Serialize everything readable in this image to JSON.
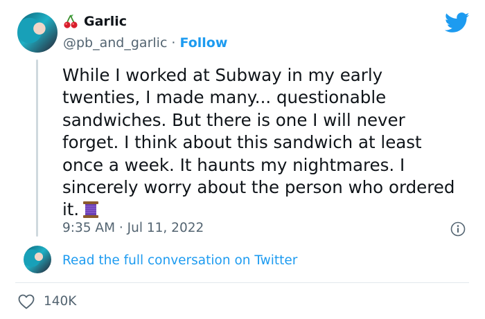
{
  "tweet": {
    "author_name": "Garlic",
    "author_emoji_icon": "cherries-icon",
    "handle": "@pb_and_garlic",
    "separator": " · ",
    "follow_label": "Follow",
    "text": "While I worked at Subway in my early twenties, I made many... questionable sandwiches. But there is one I will never forget. I think about this sandwich at least once a week. It haunts my nightmares. I sincerely worry about the person who ordered it.",
    "text_end_emoji": "thread-spool-icon",
    "timestamp": "9:35 AM · Jul 11, 2022"
  },
  "footer": {
    "read_link": "Read the full conversation on Twitter",
    "like_count": "140K"
  },
  "colors": {
    "twitter_blue": "#1d9bf0",
    "muted_text": "#536471",
    "divider": "#e1e8ed"
  }
}
